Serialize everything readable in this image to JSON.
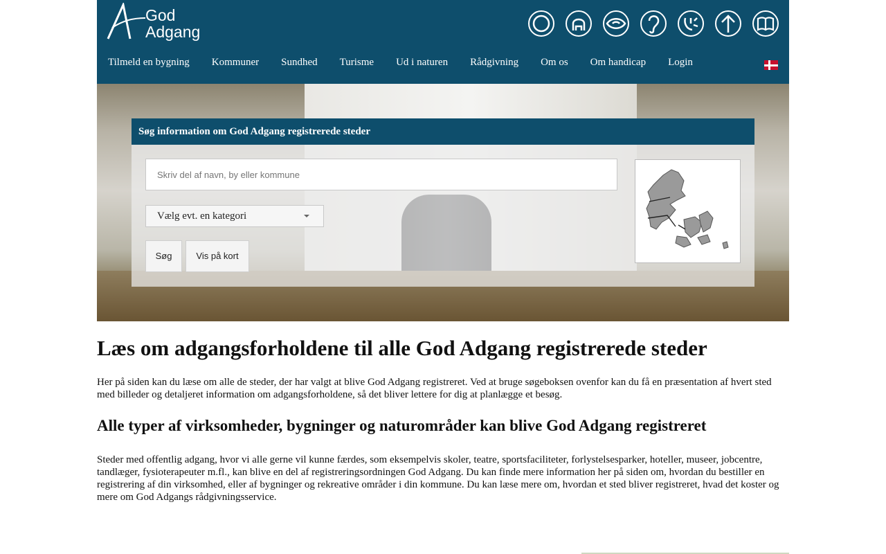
{
  "brand": {
    "logo_line1": "God",
    "logo_line2": "Adgang"
  },
  "accessibility_icons": [
    {
      "icon": "wheelchair-circle-icon"
    },
    {
      "icon": "arm-mobility-icon"
    },
    {
      "icon": "eye-vision-icon"
    },
    {
      "icon": "ear-hearing-icon"
    },
    {
      "icon": "asthma-allergy-icon"
    },
    {
      "icon": "arrow-up-icon"
    },
    {
      "icon": "book-reading-icon"
    }
  ],
  "nav": {
    "items": [
      "Tilmeld en bygning",
      "Kommuner",
      "Sundhed",
      "Turisme",
      "Ud i naturen",
      "Rådgivning",
      "Om os",
      "Om handicap",
      "Login"
    ],
    "language_flag": "danish-flag-icon"
  },
  "search": {
    "title": "Søg information om God Adgang registrerede steder",
    "placeholder": "Skriv del af navn, by eller kommune",
    "category_select": "Vælg evt. en kategori",
    "search_button": "Søg",
    "map_button": "Vis på kort"
  },
  "main": {
    "heading": "Læs om adgangsforholdene til alle God Adgang registrerede steder",
    "intro": "Her på siden kan du læse om alle de steder, der  har valgt at blive God Adgang registreret. Ved at bruge søgeboksen ovenfor kan du få en præsentation af hvert sted med billeder og detaljeret information om adgangsforholdene, så det bliver lettere for dig at planlægge et besøg.",
    "subheading": "Alle typer af virksomheder, bygninger og naturområder kan blive God Adgang registreret",
    "body": "Steder med offentlig adgang,  hvor vi alle gerne vil kunne færdes, som eksempelvis skoler, teatre, sportsfaciliteter, forlystelsesparker, hoteller, museer, jobcentre, tandlæger, fysioterapeuter m.fl., kan blive en del af registreringsordningen God Adgang. Du kan finde mere information her på siden om, hvordan du bestiller en registrering af din virksomhed,  eller af bygninger og rekreative områder i din kommune. Du kan læse mere om, hvordan et sted bliver registreret, hvad det koster og mere om God Adgangs rådgivningsservice."
  },
  "colors": {
    "header_bg": "#0e4e6c",
    "text": "#111111"
  }
}
